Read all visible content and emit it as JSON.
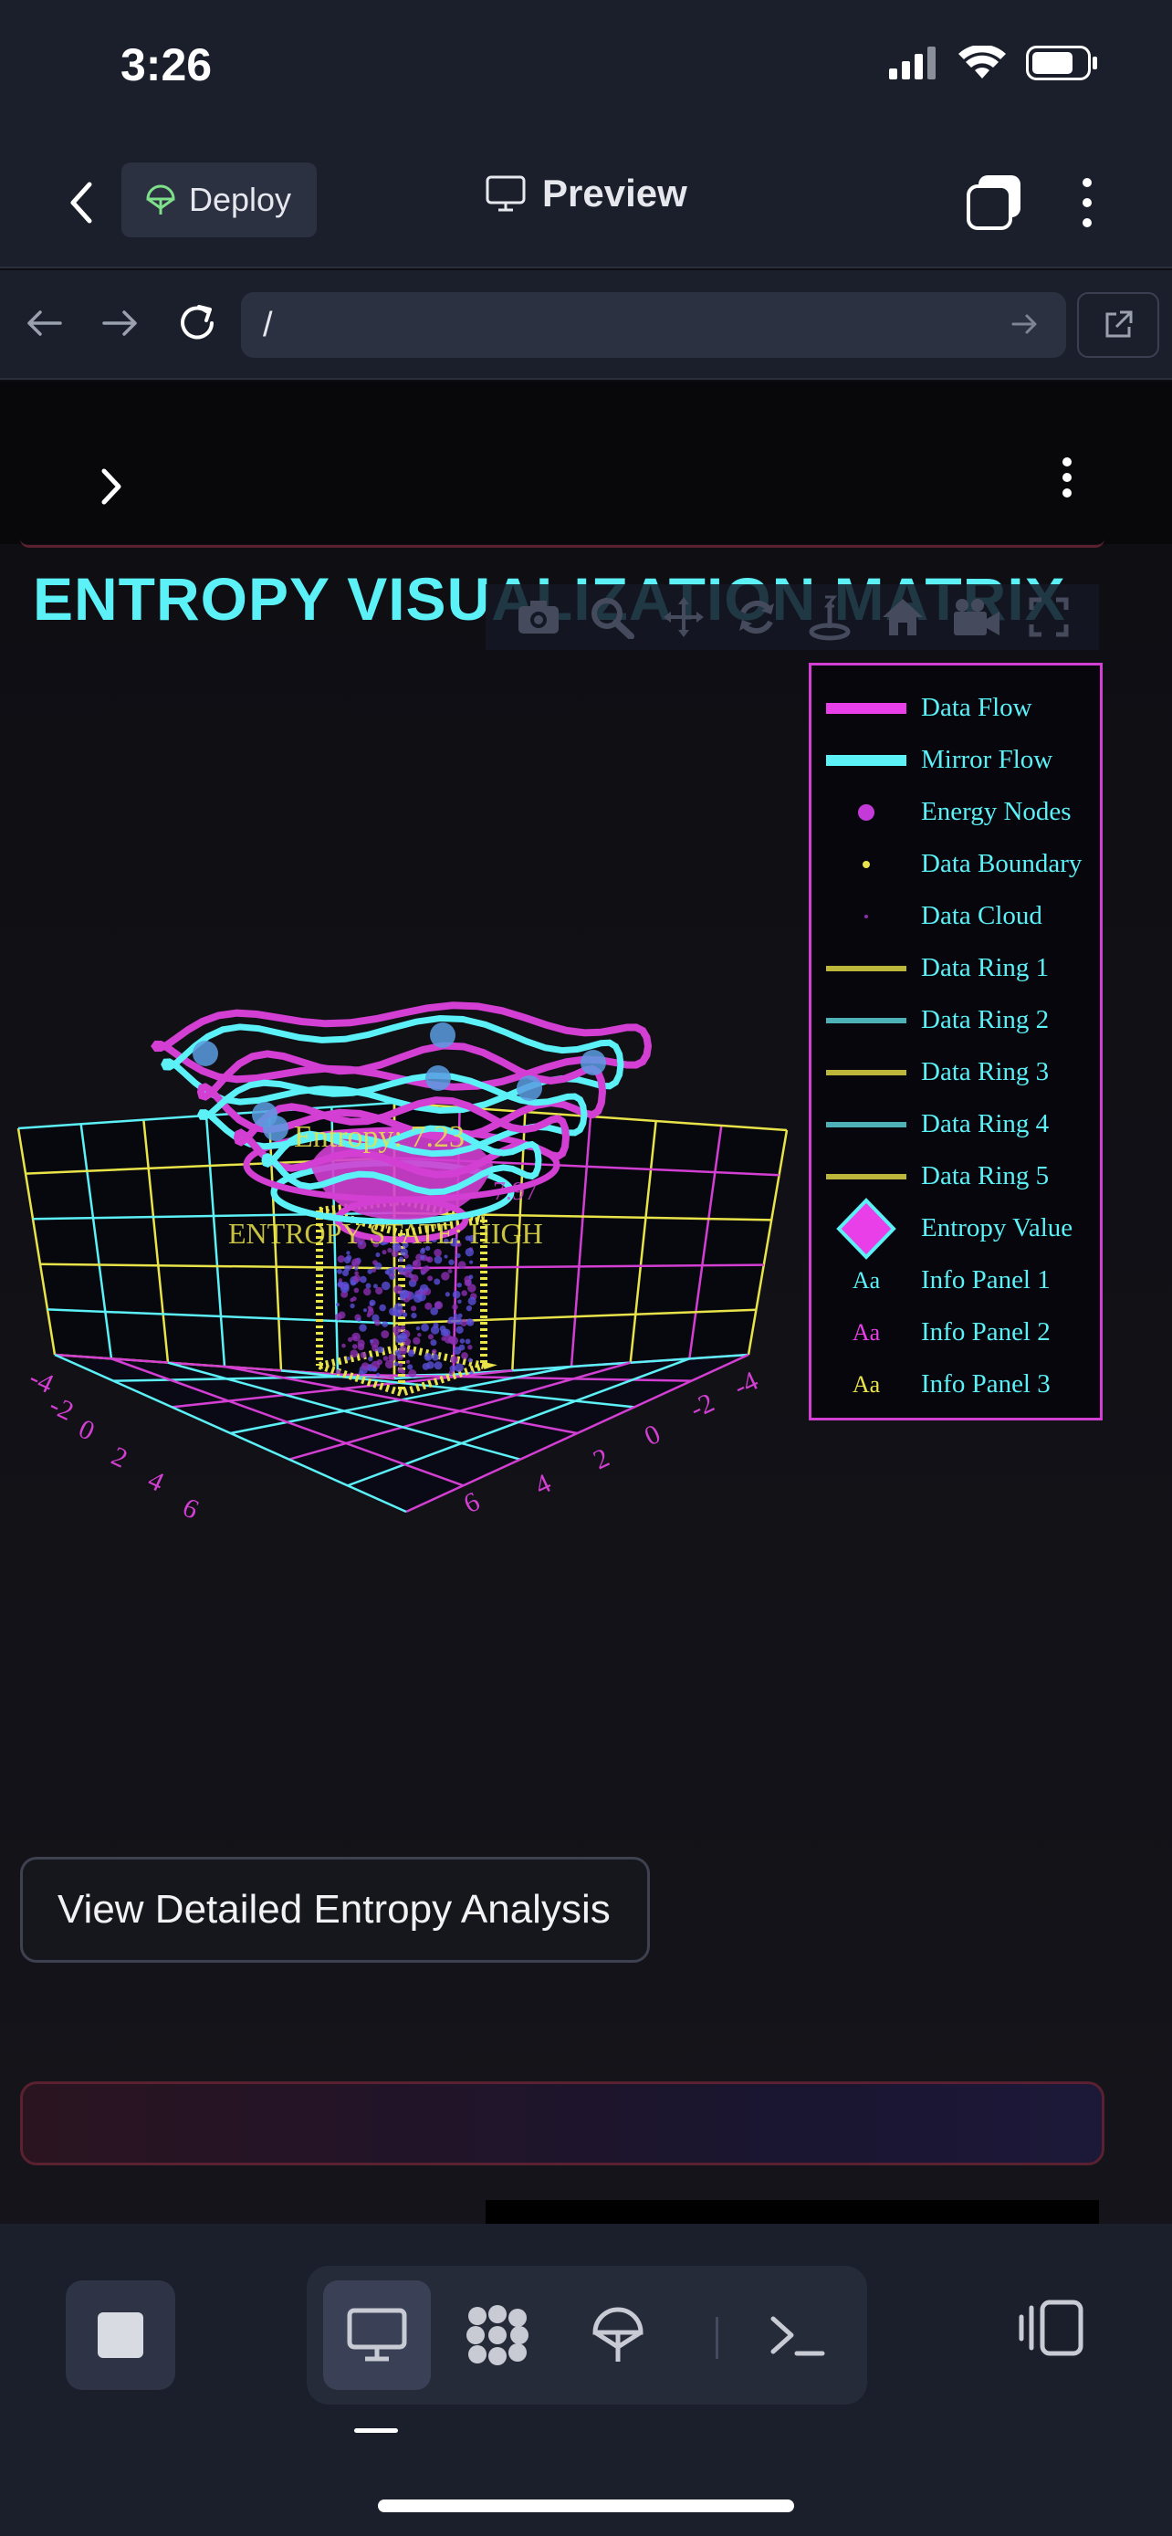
{
  "status": {
    "time": "3:26"
  },
  "topbar": {
    "deploy_label": "Deploy",
    "preview_label": "Preview"
  },
  "urlbar": {
    "url": "/"
  },
  "page": {
    "title": "ENTROPY VISUALIZATION MATRIX",
    "cta_label": "View Detailed Entropy Analysis"
  },
  "legend": {
    "items": [
      {
        "label": "Data Flow",
        "symbol": "thick-line",
        "color": "#e83fe8"
      },
      {
        "label": "Mirror Flow",
        "symbol": "thick-line",
        "color": "#5cf0f7"
      },
      {
        "label": "Energy Nodes",
        "symbol": "dot",
        "color": "#c43ad8"
      },
      {
        "label": "Data Boundary",
        "symbol": "small-dot",
        "color": "#e9e34a"
      },
      {
        "label": "Data Cloud",
        "symbol": "tiny-dot",
        "color": "#8a2fb0"
      },
      {
        "label": "Data Ring 1",
        "symbol": "line",
        "color": "#bcb63b"
      },
      {
        "label": "Data Ring 2",
        "symbol": "line",
        "color": "#4fb1b8"
      },
      {
        "label": "Data Ring 3",
        "symbol": "line",
        "color": "#bcb63b"
      },
      {
        "label": "Data Ring 4",
        "symbol": "line",
        "color": "#4fb1b8"
      },
      {
        "label": "Data Ring 5",
        "symbol": "line",
        "color": "#bcb63b"
      },
      {
        "label": "Entropy Value",
        "symbol": "diamond",
        "color": "#e83fe8"
      },
      {
        "label": "Info Panel 1",
        "symbol": "text",
        "color": "#5cf0f7",
        "glyph": "Aa"
      },
      {
        "label": "Info Panel 2",
        "symbol": "text",
        "color": "#e83fe8",
        "glyph": "Aa"
      },
      {
        "label": "Info Panel 3",
        "symbol": "text",
        "color": "#e9e34a",
        "glyph": "Aa"
      }
    ]
  },
  "chart_data": {
    "type": "scatter3d",
    "annotations": [
      "Entropy: 7.23",
      "ENTROPY STATE: HIGH",
      "7.97"
    ],
    "x_ticks": [
      "-4",
      "-2",
      "0",
      "2",
      "4",
      "6"
    ],
    "y_ticks": [
      "-4",
      "-2",
      "0",
      "2",
      "4",
      "6"
    ],
    "colors": {
      "grid_magenta": "#d23fd2",
      "grid_cyan": "#5cf0f7",
      "grid_yellow": "#e9e34a"
    }
  }
}
